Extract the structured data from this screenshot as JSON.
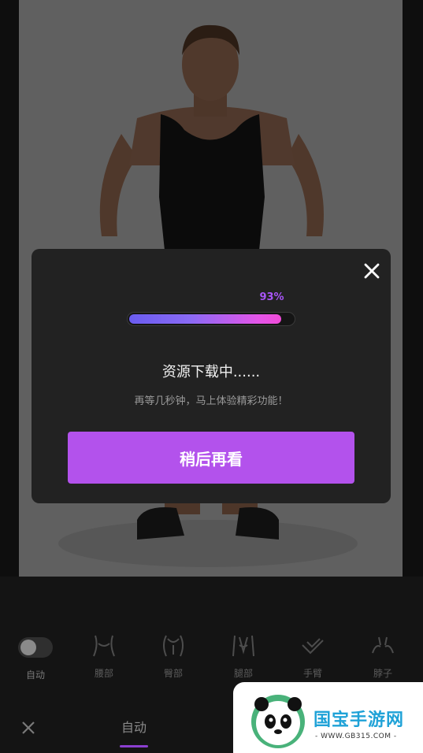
{
  "modal": {
    "progress_percent": 93,
    "progress_text": "93%",
    "title": "资源下载中......",
    "subtitle": "再等几秒钟，马上体验精彩功能！",
    "later_button": "稍后再看"
  },
  "tools": [
    {
      "label": "自动",
      "icon": "toggle-switch"
    },
    {
      "label": "腰部",
      "icon": "waist-icon"
    },
    {
      "label": "臀部",
      "icon": "hip-icon"
    },
    {
      "label": "腿部",
      "icon": "leg-icon"
    },
    {
      "label": "手臂",
      "icon": "arm-icon"
    },
    {
      "label": "脖子",
      "icon": "neck-icon"
    }
  ],
  "bottom_bar": {
    "tab_label": "自动"
  },
  "watermark": {
    "title": "国宝手游网",
    "subtitle": "- WWW.GB315.COM -"
  },
  "colors": {
    "accent": "#b352ec",
    "progress_start": "#6a5cf0",
    "progress_end": "#f04bd8",
    "modal_bg": "#222222"
  }
}
